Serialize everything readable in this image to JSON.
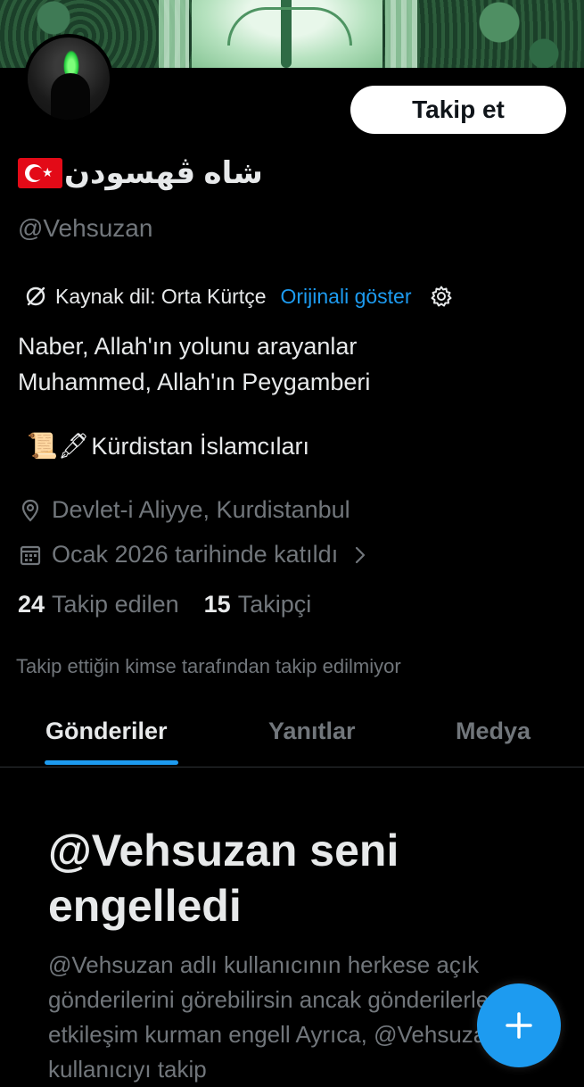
{
  "profile": {
    "display_name": "شاه ڤهسودن",
    "handle": "@Vehsuzan",
    "follow_label": "Takip et",
    "flag": "turkey-flag"
  },
  "translation": {
    "source_label": "Kaynak dil: Orta Kürtçe",
    "show_original_label": "Orijinali göster"
  },
  "bio": {
    "line1": "Naber, Allah'ın yolunu arayanlar",
    "line2": "Muhammed, Allah'ın Peygamberi",
    "emojis": "📜🖋",
    "line3": "Kürdistan İslamcıları"
  },
  "meta": {
    "location": "Devlet-i Aliyye, Kurdistanbul",
    "joined": "Ocak 2026 tarihinde katıldı"
  },
  "counts": {
    "following_count": "24",
    "following_label": "Takip edilen",
    "followers_count": "15",
    "followers_label": "Takipçi"
  },
  "not_followed_notice": "Takip ettiğin kimse tarafından takip edilmiyor",
  "tabs": [
    {
      "label": "Gönderiler",
      "active": true
    },
    {
      "label": "Yanıtlar",
      "active": false
    },
    {
      "label": "Medya",
      "active": false
    }
  ],
  "blocked": {
    "title": "@Vehsuzan seni engelledi",
    "body": "@Vehsuzan adlı kullanıcının herkese açık gönderilerini görebilirsin ancak gönderilerle etkileşim kurman engell Ayrıca, @Vehsuzan adlı kullanıcıyı takip"
  },
  "colors": {
    "background": "#000000",
    "accent": "#1d9bf0",
    "secondary_text": "#71767b",
    "primary_text": "#e7e9ea"
  },
  "icons": [
    "translate-icon",
    "gear-icon",
    "location-pin-icon",
    "calendar-icon",
    "chevron-right-icon",
    "plus-icon"
  ]
}
